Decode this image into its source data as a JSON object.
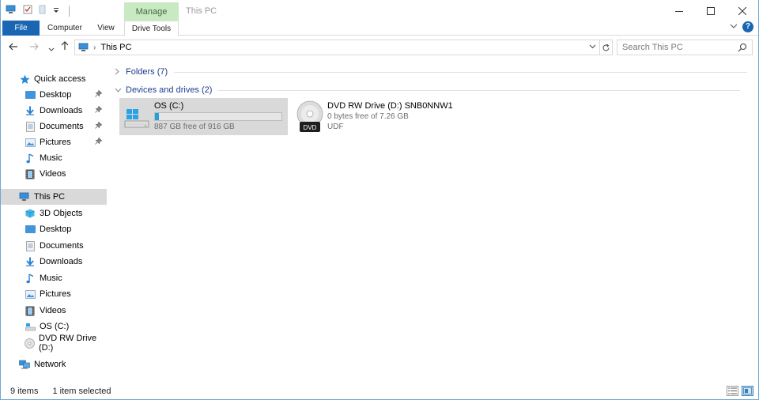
{
  "window": {
    "title": "This PC",
    "context_tab_header": "Manage"
  },
  "ribbon": {
    "tabs": [
      {
        "label": "File"
      },
      {
        "label": "Computer"
      },
      {
        "label": "View"
      },
      {
        "label": "Drive Tools"
      }
    ]
  },
  "address": {
    "crumbs": [
      "This PC"
    ]
  },
  "search": {
    "placeholder": "Search This PC"
  },
  "nav": {
    "quick_access": {
      "label": "Quick access",
      "items": [
        {
          "label": "Desktop",
          "pinned": true
        },
        {
          "label": "Downloads",
          "pinned": true
        },
        {
          "label": "Documents",
          "pinned": true
        },
        {
          "label": "Pictures",
          "pinned": true
        },
        {
          "label": "Music",
          "pinned": false
        },
        {
          "label": "Videos",
          "pinned": false
        }
      ]
    },
    "this_pc": {
      "label": "This PC",
      "items": [
        {
          "label": "3D Objects"
        },
        {
          "label": "Desktop"
        },
        {
          "label": "Documents"
        },
        {
          "label": "Downloads"
        },
        {
          "label": "Music"
        },
        {
          "label": "Pictures"
        },
        {
          "label": "Videos"
        },
        {
          "label": "OS (C:)"
        },
        {
          "label": "DVD RW Drive (D:)"
        }
      ]
    },
    "network": {
      "label": "Network"
    }
  },
  "content": {
    "groups": [
      {
        "label": "Folders (7)",
        "expanded": false
      },
      {
        "label": "Devices and drives (2)",
        "expanded": true
      }
    ],
    "drives": [
      {
        "name": "OS (C:)",
        "free_text": "887 GB free of 916 GB",
        "used_fraction": 0.032,
        "selected": true
      },
      {
        "name": "DVD RW Drive (D:) SNB0NNW1",
        "free_text": "0 bytes free of 7.26 GB",
        "filesystem": "UDF",
        "badge": "DVD",
        "selected": false
      }
    ]
  },
  "status": {
    "item_count": "9 items",
    "selection": "1 item selected"
  },
  "colors": {
    "file_tab": "#1a66b3",
    "context_tab": "#c8e9c2",
    "selection": "#d9d9d9",
    "group_header": "#1e3d8f",
    "drive_bar": "#26a0da"
  }
}
